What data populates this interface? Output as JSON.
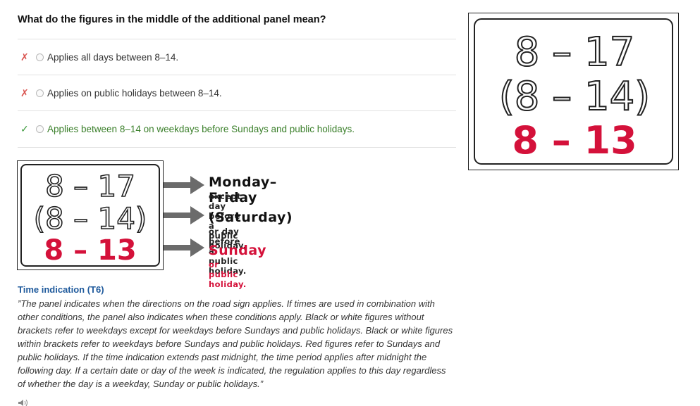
{
  "question": "What do the figures in the middle of the additional panel mean?",
  "options": [
    {
      "label": "Applies all days between 8–14.",
      "result": "wrong",
      "mark": "✗"
    },
    {
      "label": "Applies on public holidays between 8–14.",
      "result": "wrong",
      "mark": "✗"
    },
    {
      "label": "Applies between 8–14 on weekdays before Sundays and public holidays.",
      "result": "correct",
      "mark": "✓"
    }
  ],
  "sign": {
    "line1": "8 – 17",
    "line2": "(8 – 14)",
    "line3": "8 – 13"
  },
  "explanation": [
    {
      "heading": "Monday–Friday",
      "sub": "except day before a public holiday."
    },
    {
      "heading": "(Saturday)",
      "sub": "or day before a public holiday."
    },
    {
      "heading": "Sunday",
      "sub": "or public holiday."
    }
  ],
  "description": {
    "title": "Time indication (T6)",
    "body": "”The panel indicates when the directions on the road sign applies. If times are used in combination with other conditions, the panel also indicates when these conditions apply. Black or white figures without brackets refer to weekdays except for weekdays before Sundays and public holidays. Black or white figures within brackets refer to weekdays before Sundays and public holidays. Red figures refer to Sundays and public holidays. If the time indication extends past midnight, the time period applies after midnight the following day. If a certain date or day of the week is indicated, the regulation applies to this day regardless of whether the day is a weekday, Sunday or public holidays.”"
  },
  "colors": {
    "red": "#d4113a",
    "correct_green": "#3a7f2a",
    "wrong_red": "#d9534f",
    "title_blue": "#1f5a9c",
    "arrow_gray": "#6b6b6b"
  },
  "icons": {
    "speaker": "speaker-icon",
    "arrow": "arrow-right-icon"
  }
}
